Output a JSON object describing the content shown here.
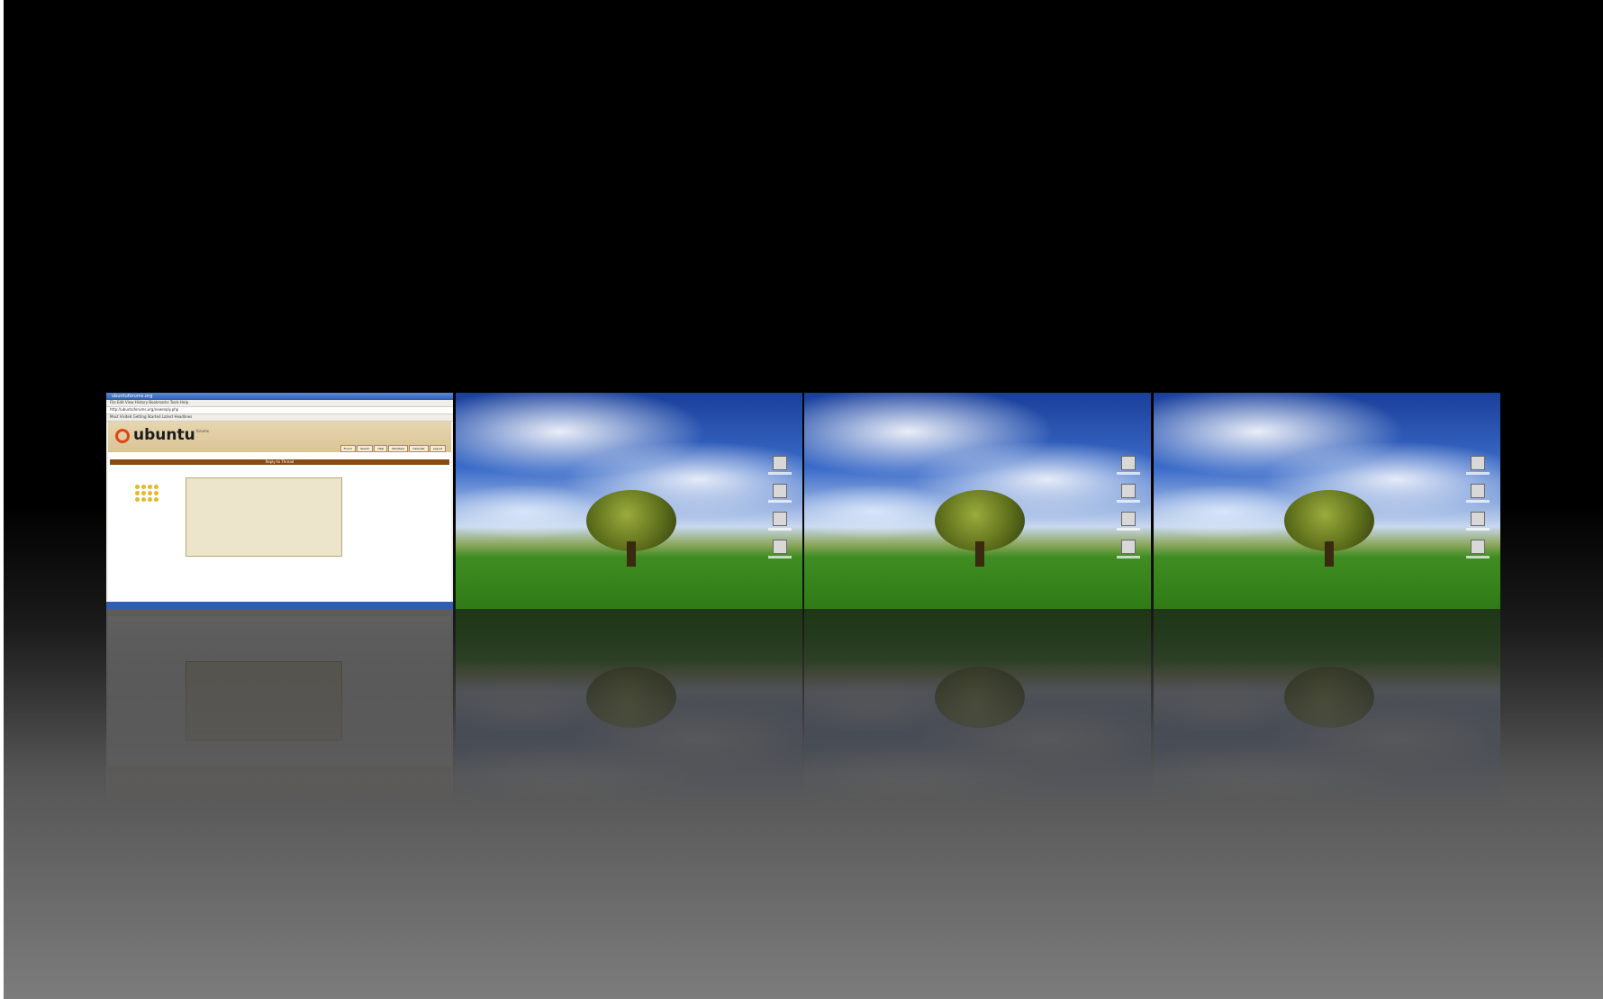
{
  "browser": {
    "title": "ubuntuforums.org",
    "menu": "File  Edit  View  History  Bookmarks  Tools  Help",
    "address": "http://ubuntuforums.org/newreply.php",
    "bookmarks": "Most Visited  Getting Started  Latest Headlines",
    "logo_text": "ubuntu",
    "logo_sub": "forums",
    "tabs": [
      "Forum",
      "Search",
      "Help",
      "Members",
      "Calendar",
      "Logout"
    ],
    "bar_label": "Reply to Thread"
  },
  "colors": {
    "ubuntu_orange": "#dd4814",
    "banner": "#d9c495",
    "bar_brown": "#8a4b12"
  },
  "workspaces": [
    {
      "type": "browser"
    },
    {
      "type": "desktop"
    },
    {
      "type": "desktop"
    },
    {
      "type": "desktop"
    }
  ],
  "desktop_icons": [
    "computer-icon",
    "home-icon",
    "trash-icon",
    "drive-icon"
  ]
}
